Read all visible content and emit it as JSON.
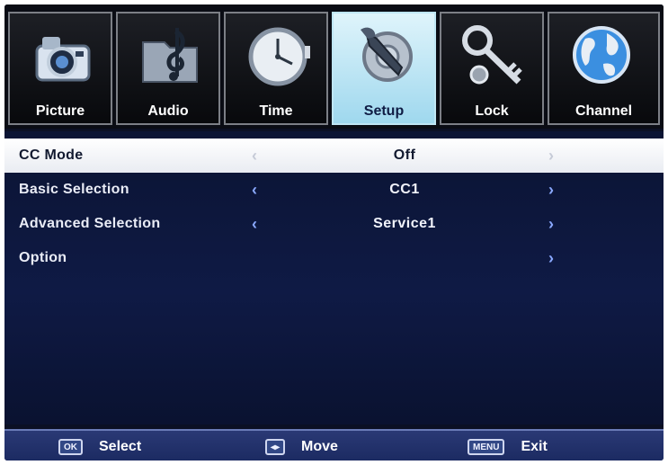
{
  "tabs": [
    {
      "label": "Picture",
      "icon": "camera-icon",
      "active": false
    },
    {
      "label": "Audio",
      "icon": "music-note-icon",
      "active": false
    },
    {
      "label": "Time",
      "icon": "clock-icon",
      "active": false
    },
    {
      "label": "Setup",
      "icon": "wrench-gear-icon",
      "active": true
    },
    {
      "label": "Lock",
      "icon": "key-icon",
      "active": false
    },
    {
      "label": "Channel",
      "icon": "globe-icon",
      "active": false
    }
  ],
  "menu": {
    "rows": [
      {
        "label": "CC Mode",
        "value": "Off",
        "left_arrow": "‹",
        "right_arrow": "›",
        "selected": true
      },
      {
        "label": "Basic Selection",
        "value": "CC1",
        "left_arrow": "‹",
        "right_arrow": "›",
        "selected": false
      },
      {
        "label": "Advanced Selection",
        "value": "Service1",
        "left_arrow": "‹",
        "right_arrow": "›",
        "selected": false
      },
      {
        "label": "Option",
        "value": "",
        "left_arrow": "",
        "right_arrow": "›",
        "selected": false
      }
    ]
  },
  "footer": {
    "select": {
      "key_label": "OK",
      "label": "Select"
    },
    "move": {
      "key_label": "◂▸",
      "label": "Move"
    },
    "exit": {
      "key_label": "MENU",
      "label": "Exit"
    }
  },
  "colors": {
    "background": "#0b1024",
    "active_tab": "#bfe6f4",
    "selected_row": "#ffffff",
    "arrow": "#8aa9ff",
    "footer": "#23326a"
  }
}
